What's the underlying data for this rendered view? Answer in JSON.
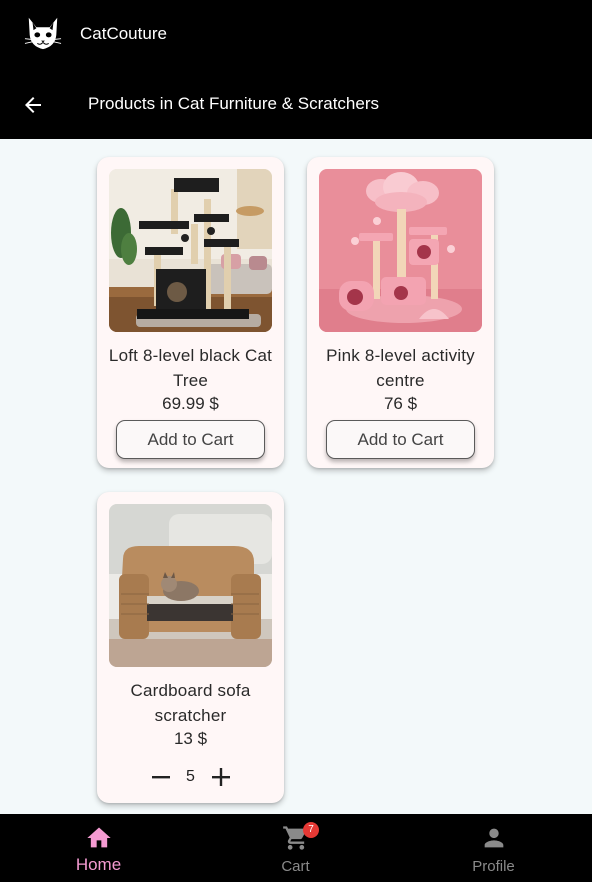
{
  "app": {
    "name": "CatCouture",
    "logo_icon": "cat-face-icon"
  },
  "header": {
    "title": "Products in Cat Furniture & Scratchers",
    "back_icon": "arrow-left-icon"
  },
  "products": [
    {
      "name": "Loft 8-level black Cat Tree",
      "price": "69.99 $",
      "action_label": "Add to Cart",
      "image": "black-cat-tree-photo"
    },
    {
      "name": "Pink 8-level activity centre",
      "price": "76 $",
      "action_label": "Add to Cart",
      "image": "pink-cat-tree-photo"
    },
    {
      "name": "Cardboard sofa scratcher",
      "price": "13 $",
      "quantity": "5",
      "image": "cardboard-sofa-photo"
    }
  ],
  "nav": {
    "items": [
      {
        "label": "Home",
        "icon": "home-icon",
        "active": true
      },
      {
        "label": "Cart",
        "icon": "cart-icon",
        "badge": "7"
      },
      {
        "label": "Profile",
        "icon": "person-icon"
      }
    ]
  },
  "colors": {
    "accent": "#f59bd2",
    "header_bg": "#000000",
    "badge": "#e53935",
    "card_bg": "#fff7f7",
    "page_bg": "#f3f9fa"
  }
}
